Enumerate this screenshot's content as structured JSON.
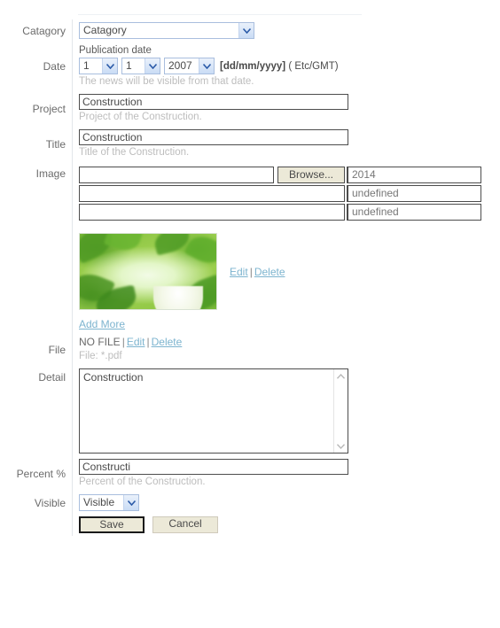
{
  "form": {
    "rows": {
      "category": {
        "label": "Catagory",
        "select_value": "Catagory"
      },
      "date": {
        "label": "Date",
        "title": "Publication date",
        "day": "1",
        "month": "1",
        "year": "2007",
        "format": "[dd/mm/yyyy]",
        "timezone": "( Etc/GMT)",
        "hint": "The news will be visible from that date."
      },
      "project": {
        "label": "Project",
        "value": "Construction",
        "hint": "Project of the Construction."
      },
      "title": {
        "label": "Title",
        "value": "Construction",
        "hint": "Title of the Construction."
      },
      "image": {
        "label": "Image",
        "browse_label": "Browse...",
        "uploads": [
          {
            "file_value": "",
            "name": "2014",
            "has_browse": true
          },
          {
            "file_value": "",
            "name": "undefined",
            "has_browse": false
          },
          {
            "file_value": "",
            "name": "undefined",
            "has_browse": false
          }
        ],
        "thumb_edit": "Edit",
        "thumb_delete": "Delete",
        "separator": "|",
        "add_more": "Add More"
      },
      "file": {
        "label": "File",
        "status": "NO FILE",
        "edit": "Edit",
        "delete": "Delete",
        "separator": "|",
        "hint": "File: *.pdf"
      },
      "detail": {
        "label": "Detail",
        "value": "Construction"
      },
      "percent": {
        "label": "Percent %",
        "value": "Constructi",
        "hint": "Percent of the Construction."
      },
      "visible": {
        "label": "Visible",
        "select_value": "Visible"
      }
    },
    "actions": {
      "save": "Save",
      "cancel": "Cancel"
    }
  },
  "colors": {
    "link": "#7db4cf",
    "hint": "#bdbdbd",
    "label": "#6b6b6b",
    "button_face": "#ece9d8",
    "select_border": "#a9bede"
  }
}
